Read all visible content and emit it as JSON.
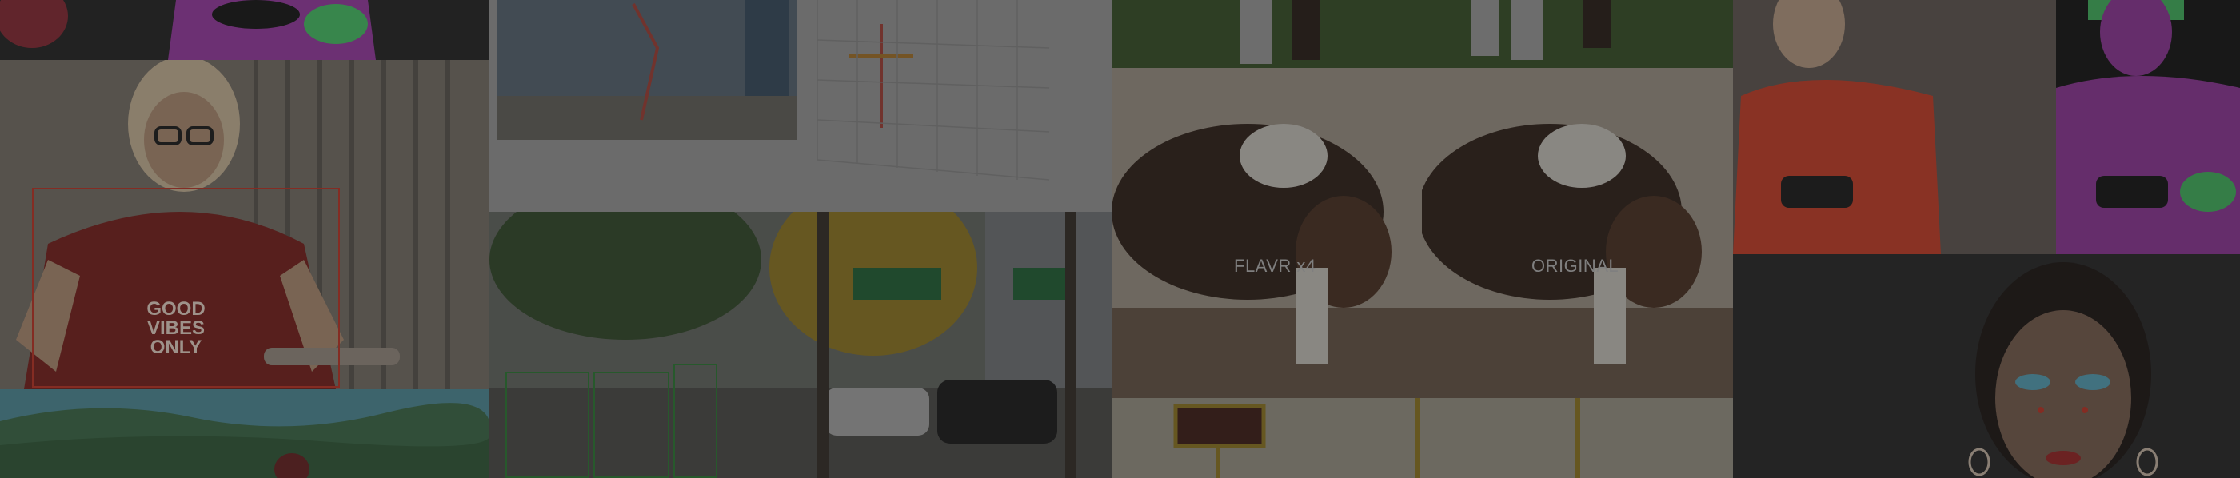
{
  "tiles": {
    "interpolation": {
      "left_caption": "FLAVR x4",
      "right_caption": "ORIGINAL"
    },
    "detection": {
      "shirt_lines": [
        "GOOD",
        "VIBES",
        "ONLY"
      ]
    }
  },
  "colors": {
    "background": "#2b2b2b",
    "overlay": "rgba(20,20,20,0.55)",
    "bbox_red": "#c0392b",
    "bbox_green": "#3fae49",
    "segmentation_purple": "#9b3fa6",
    "segmentation_green": "#4cc36a"
  }
}
